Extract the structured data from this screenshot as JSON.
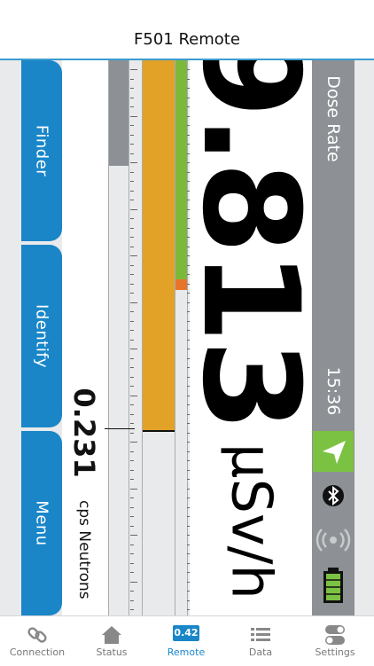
{
  "header": {
    "title": "F501 Remote"
  },
  "left_buttons": [
    {
      "label": "Finder"
    },
    {
      "label": "Identify"
    },
    {
      "label": "Menu"
    }
  ],
  "neutron": {
    "value": "0.231",
    "unit": "cps Neutrons"
  },
  "dose": {
    "value": "9.813",
    "unit": "µSv/h",
    "label": "Dose Rate"
  },
  "status": {
    "time": "15:36"
  },
  "gauges": {
    "gray_level": 0.19,
    "orange_level": 0.67,
    "green_level": 0.41
  },
  "colors": {
    "accent": "#1a86c8",
    "gauge_orange": "#e2a227",
    "gauge_green": "#7cb93a",
    "status_gray": "#8d9195",
    "battery_green": "#7cc242"
  },
  "tabs": [
    {
      "label": "Connection",
      "icon": "link-icon"
    },
    {
      "label": "Status",
      "icon": "home-icon"
    },
    {
      "label": "Remote",
      "icon": "remote-icon",
      "badge": "0.42",
      "active": true
    },
    {
      "label": "Data",
      "icon": "list-icon"
    },
    {
      "label": "Settings",
      "icon": "toggle-icon"
    }
  ]
}
